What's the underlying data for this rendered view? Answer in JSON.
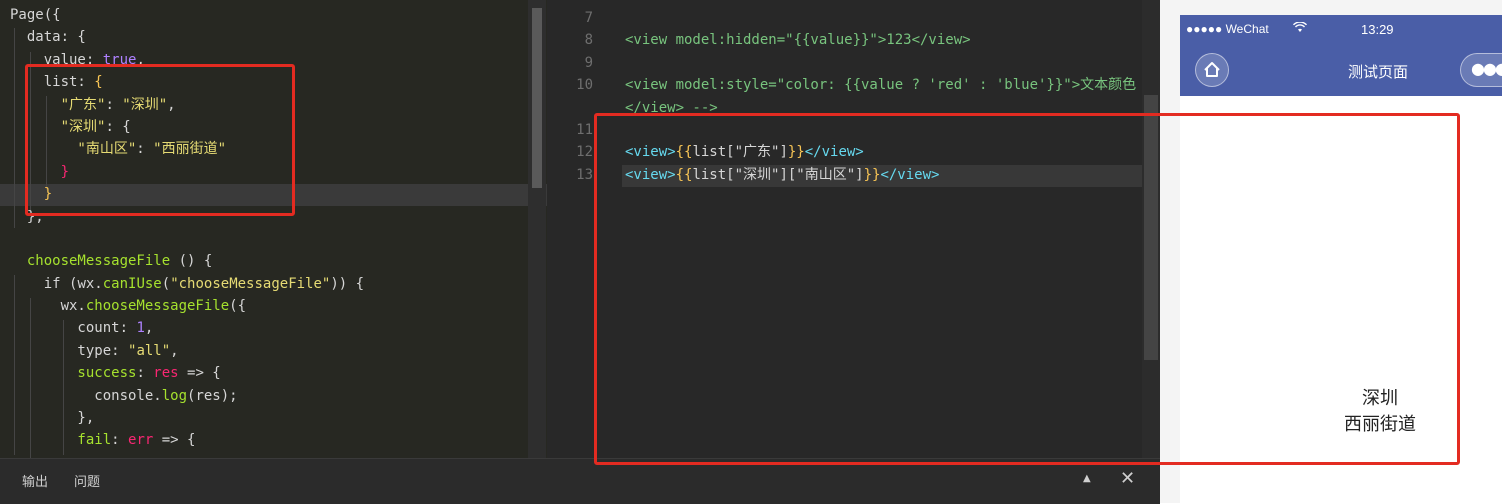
{
  "left_editor": {
    "lines": [
      [
        {
          "t": "Page({",
          "c": "punc"
        }
      ],
      [
        {
          "t": "  data: {",
          "c": "punc"
        }
      ],
      [
        {
          "t": "    value: ",
          "c": "punc"
        },
        {
          "t": "true",
          "c": "bool"
        },
        {
          "t": ",",
          "c": "punc"
        }
      ],
      [
        {
          "t": "    list: ",
          "c": "punc"
        },
        {
          "t": "{",
          "c": "brace"
        }
      ],
      [
        {
          "t": "      \"广东\"",
          "c": "str"
        },
        {
          "t": ": ",
          "c": "punc"
        },
        {
          "t": "\"深圳\"",
          "c": "str"
        },
        {
          "t": ",",
          "c": "punc"
        }
      ],
      [
        {
          "t": "      \"深圳\"",
          "c": "str"
        },
        {
          "t": ": {",
          "c": "punc"
        }
      ],
      [
        {
          "t": "        \"南山区\"",
          "c": "str"
        },
        {
          "t": ": ",
          "c": "punc"
        },
        {
          "t": "\"西丽街道\"",
          "c": "str"
        }
      ],
      [
        {
          "t": "      }",
          "c": "kw"
        }
      ],
      [
        {
          "t": "    }",
          "c": "brace"
        }
      ],
      [
        {
          "t": "  },",
          "c": "punc"
        }
      ],
      [
        {
          "t": "",
          "c": "punc"
        }
      ],
      [
        {
          "t": "  chooseMessageFile",
          "c": "fn"
        },
        {
          "t": " () {",
          "c": "punc"
        }
      ],
      [
        {
          "t": "    if ",
          "c": "punc"
        },
        {
          "t": "(wx.",
          "c": "punc"
        },
        {
          "t": "canIUse",
          "c": "fn"
        },
        {
          "t": "(",
          "c": "punc"
        },
        {
          "t": "\"chooseMessageFile\"",
          "c": "str"
        },
        {
          "t": ")) {",
          "c": "punc"
        }
      ],
      [
        {
          "t": "      wx.",
          "c": "punc"
        },
        {
          "t": "chooseMessageFile",
          "c": "fn"
        },
        {
          "t": "({",
          "c": "punc"
        }
      ],
      [
        {
          "t": "        count: ",
          "c": "punc"
        },
        {
          "t": "1",
          "c": "bool"
        },
        {
          "t": ",",
          "c": "punc"
        }
      ],
      [
        {
          "t": "        type: ",
          "c": "punc"
        },
        {
          "t": "\"all\"",
          "c": "str"
        },
        {
          "t": ",",
          "c": "punc"
        }
      ],
      [
        {
          "t": "        success",
          "c": "fn"
        },
        {
          "t": ": ",
          "c": "punc"
        },
        {
          "t": "res",
          "c": "kw"
        },
        {
          "t": " => {",
          "c": "punc"
        }
      ],
      [
        {
          "t": "          console.",
          "c": "punc"
        },
        {
          "t": "log",
          "c": "fn"
        },
        {
          "t": "(res);",
          "c": "punc"
        }
      ],
      [
        {
          "t": "        },",
          "c": "punc"
        }
      ],
      [
        {
          "t": "        fail",
          "c": "fn"
        },
        {
          "t": ": ",
          "c": "punc"
        },
        {
          "t": "err",
          "c": "kw"
        },
        {
          "t": " => {",
          "c": "punc"
        }
      ]
    ]
  },
  "right_editor": {
    "line_numbers": [
      "7",
      "8",
      "9",
      "10",
      "",
      "11",
      "12",
      "13"
    ],
    "lines": [
      [
        {
          "t": "",
          "c": "punc"
        }
      ],
      [
        {
          "t": "<view model:hidden=\"{{value}}\">123</view>",
          "c": "green"
        }
      ],
      [
        {
          "t": "",
          "c": "punc"
        }
      ],
      [
        {
          "t": "<view model:style=\"color: {{value ? 'red' : 'blue'}}\">文本颜色",
          "c": "green"
        }
      ],
      [
        {
          "t": "</view> -->",
          "c": "green"
        }
      ],
      [
        {
          "t": "",
          "c": "punc"
        }
      ],
      [
        {
          "t": "<view>",
          "c": "tag"
        },
        {
          "t": "{{",
          "c": "brace"
        },
        {
          "t": "list[\"广东\"]",
          "c": "punc"
        },
        {
          "t": "}}",
          "c": "brace"
        },
        {
          "t": "</view>",
          "c": "tag"
        }
      ],
      [
        {
          "t": "<view>",
          "c": "tag"
        },
        {
          "t": "{{",
          "c": "brace"
        },
        {
          "t": "list[\"深圳\"][\"南山区\"]",
          "c": "punc"
        },
        {
          "t": "}}",
          "c": "brace"
        },
        {
          "t": "</view>",
          "c": "tag"
        }
      ]
    ]
  },
  "bottom_panel": {
    "tabs": [
      "输出",
      "问题"
    ],
    "collapse_icon": "triangle-up-icon",
    "close_icon": "close-icon"
  },
  "phone": {
    "signal": "●●●●● WeChat",
    "time": "13:29",
    "nav_title": "测试页面",
    "home_icon": "home-icon",
    "more_icon": "more-dots-icon",
    "content_lines": [
      "深圳",
      "西丽街道"
    ]
  },
  "colors": {
    "highlight_box": "#e32b21",
    "nav_bar": "#4a5ea7"
  }
}
